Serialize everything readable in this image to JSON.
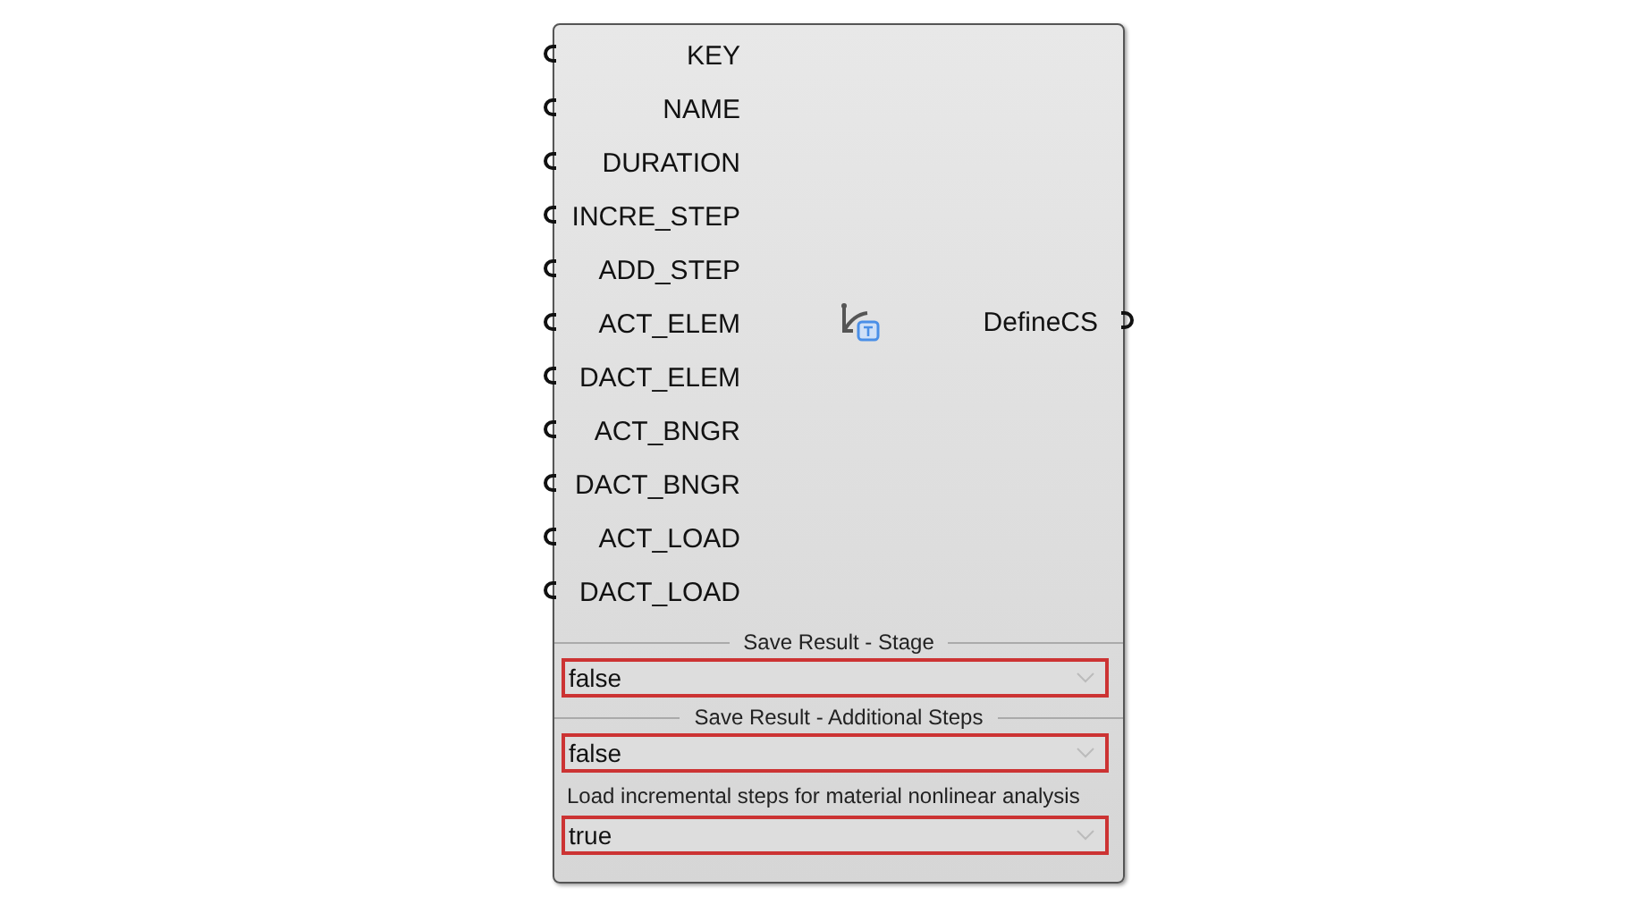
{
  "component": {
    "inputs": [
      "KEY",
      "NAME",
      "DURATION",
      "INCRE_STEP",
      "ADD_STEP",
      "ACT_ELEM",
      "DACT_ELEM",
      "ACT_BNGR",
      "DACT_BNGR",
      "ACT_LOAD",
      "DACT_LOAD"
    ],
    "outputs": [
      "DefineCS"
    ],
    "options": [
      {
        "kind": "divider",
        "title": "Save Result - Stage",
        "value": "false"
      },
      {
        "kind": "divider",
        "title": "Save Result - Additional Steps",
        "value": "false"
      },
      {
        "kind": "caption",
        "title": "Load incremental steps for material nonlinear analysis",
        "value": "true"
      }
    ]
  }
}
